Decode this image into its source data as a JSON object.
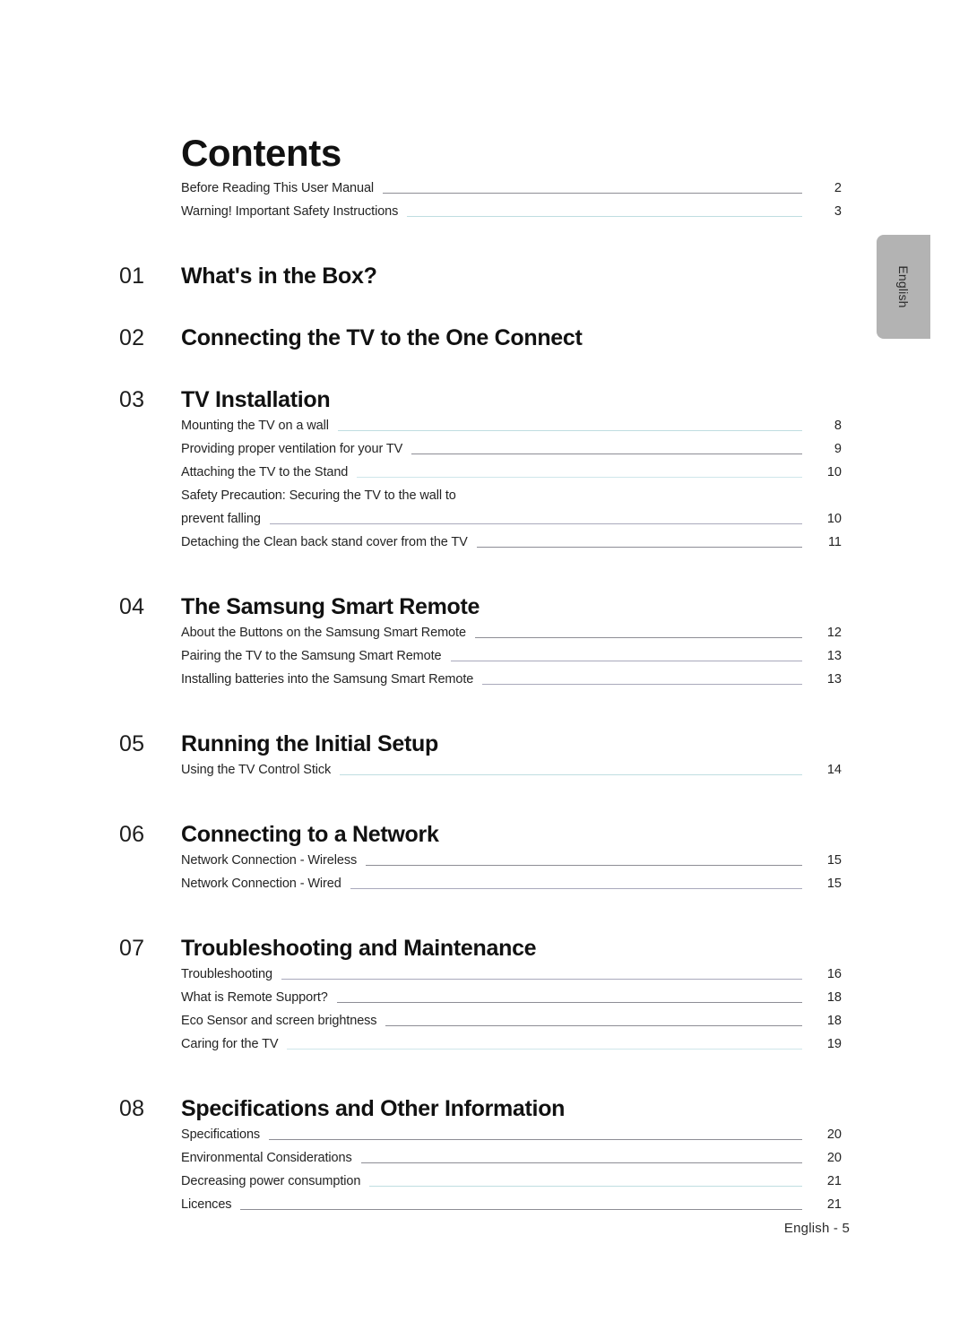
{
  "document": {
    "title": "Contents",
    "language_tab": "English",
    "footer": "English - 5"
  },
  "front_matter": [
    {
      "label": "Before Reading This User Manual",
      "page": "2",
      "leader": "gray"
    },
    {
      "label": "Warning! Important Safety Instructions",
      "page": "3",
      "leader": "teal"
    }
  ],
  "chapters": [
    {
      "number": "01",
      "title": "What's in the Box?",
      "items": []
    },
    {
      "number": "02",
      "title": "Connecting the TV to the One Connect",
      "items": []
    },
    {
      "number": "03",
      "title": "TV Installation",
      "items": [
        {
          "label": "Mounting the TV on a wall",
          "page": "8",
          "leader": "teal"
        },
        {
          "label": "Providing proper ventilation for your TV",
          "page": "9",
          "leader": "gray"
        },
        {
          "label": "Attaching the TV to the Stand",
          "page": "10",
          "leader": "pale"
        },
        {
          "label": "Safety Precaution: Securing the TV to the wall to",
          "page": "",
          "leader": "none"
        },
        {
          "label": "prevent falling",
          "page": "10",
          "leader": "lav"
        },
        {
          "label": "Detaching the Clean back stand cover from the TV",
          "page": "11",
          "leader": "gray"
        }
      ]
    },
    {
      "number": "04",
      "title": "The Samsung Smart Remote",
      "items": [
        {
          "label": "About the Buttons on the Samsung Smart Remote",
          "page": "12",
          "leader": "gray"
        },
        {
          "label": "Pairing the TV to the Samsung Smart Remote",
          "page": "13",
          "leader": "lav"
        },
        {
          "label": "Installing batteries into the Samsung Smart Remote",
          "page": "13",
          "leader": "lav"
        }
      ]
    },
    {
      "number": "05",
      "title": "Running the Initial Setup",
      "items": [
        {
          "label": "Using the TV Control Stick",
          "page": "14",
          "leader": "teal"
        }
      ]
    },
    {
      "number": "06",
      "title": "Connecting to a Network",
      "items": [
        {
          "label": "Network Connection - Wireless",
          "page": "15",
          "leader": "gray"
        },
        {
          "label": "Network Connection - Wired",
          "page": "15",
          "leader": "lav"
        }
      ]
    },
    {
      "number": "07",
      "title": "Troubleshooting and Maintenance",
      "items": [
        {
          "label": "Troubleshooting",
          "page": "16",
          "leader": "lav"
        },
        {
          "label": "What is Remote Support?",
          "page": "18",
          "leader": "gray"
        },
        {
          "label": "Eco Sensor and screen brightness",
          "page": "18",
          "leader": "gray"
        },
        {
          "label": "Caring for the TV",
          "page": "19",
          "leader": "pale"
        }
      ]
    },
    {
      "number": "08",
      "title": "Specifications and Other Information",
      "items": [
        {
          "label": "Specifications",
          "page": "20",
          "leader": "gray"
        },
        {
          "label": "Environmental Considerations",
          "page": "20",
          "leader": "gray"
        },
        {
          "label": "Decreasing power consumption",
          "page": "21",
          "leader": "teal"
        },
        {
          "label": "Licences",
          "page": "21",
          "leader": "gray"
        }
      ]
    }
  ],
  "colors": {
    "tab_background": "#b3b3b3",
    "leader_gray": "#8d8d95",
    "leader_teal": "#bfdde1",
    "leader_lavender": "#a9a9bb",
    "text": "#1b1b1b"
  }
}
